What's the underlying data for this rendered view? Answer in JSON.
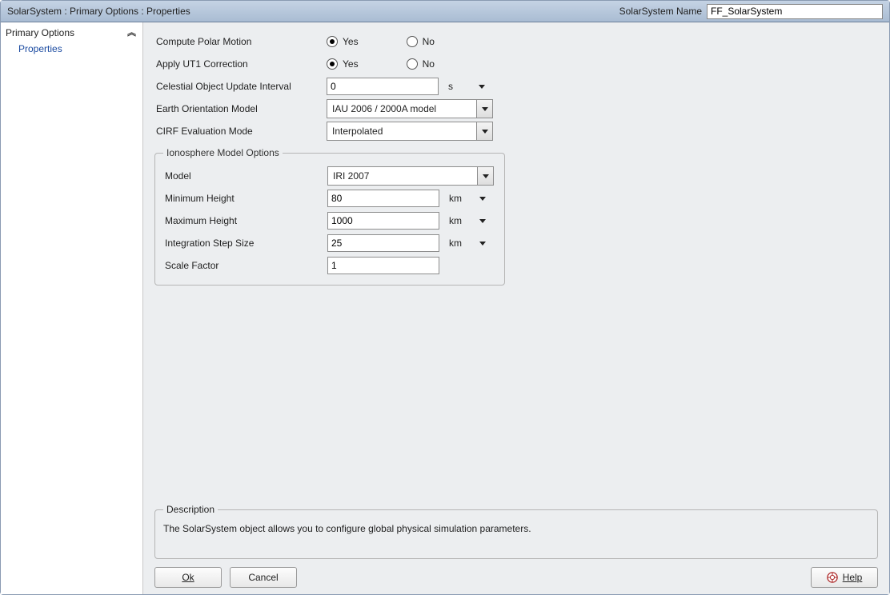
{
  "titlebar": {
    "breadcrumb": "SolarSystem : Primary Options : Properties",
    "name_label": "SolarSystem Name",
    "name_value": "FF_SolarSystem"
  },
  "sidebar": {
    "root": "Primary Options",
    "items": [
      "Properties"
    ]
  },
  "form": {
    "compute_polar_motion": {
      "label": "Compute Polar Motion",
      "yes": "Yes",
      "no": "No",
      "selected": "yes"
    },
    "apply_ut1": {
      "label": "Apply UT1 Correction",
      "yes": "Yes",
      "no": "No",
      "selected": "yes"
    },
    "update_interval": {
      "label": "Celestial Object Update Interval",
      "value": "0",
      "unit": "s"
    },
    "earth_orientation": {
      "label": "Earth Orientation Model",
      "value": "IAU 2006 / 2000A model"
    },
    "cirf_mode": {
      "label": "CIRF Evaluation Mode",
      "value": "Interpolated"
    },
    "ionosphere": {
      "legend": "Ionosphere Model Options",
      "model": {
        "label": "Model",
        "value": "IRI 2007"
      },
      "min_height": {
        "label": "Minimum Height",
        "value": "80",
        "unit": "km"
      },
      "max_height": {
        "label": "Maximum Height",
        "value": "1000",
        "unit": "km"
      },
      "step_size": {
        "label": "Integration Step Size",
        "value": "25",
        "unit": "km"
      },
      "scale_factor": {
        "label": "Scale Factor",
        "value": "1"
      }
    }
  },
  "description": {
    "legend": "Description",
    "text": "The SolarSystem object allows you to configure global physical simulation parameters."
  },
  "buttons": {
    "ok": "Ok",
    "cancel": "Cancel",
    "help": "Help"
  }
}
